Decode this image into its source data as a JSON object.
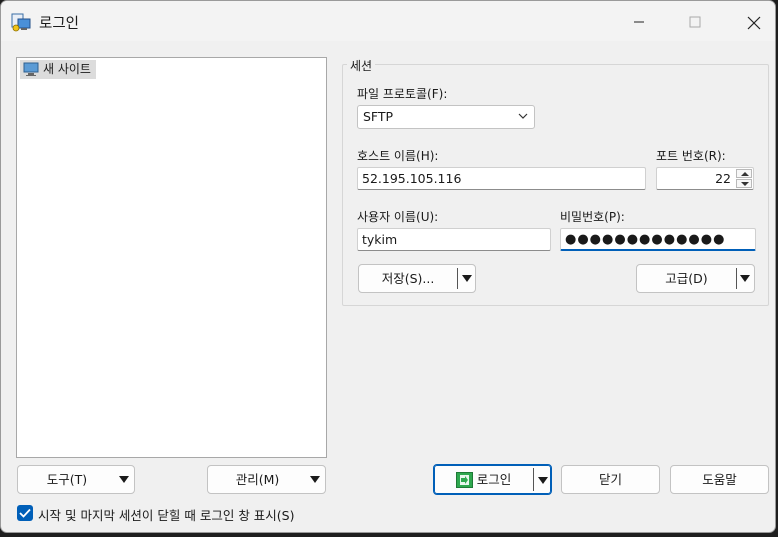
{
  "window": {
    "title": "로그인"
  },
  "site_tree": {
    "items": [
      {
        "label": "새 사이트",
        "icon": "new-site-icon"
      }
    ]
  },
  "session": {
    "group_label": "세션",
    "protocol_label": "파일 프로토콜(F):",
    "protocol_value": "SFTP",
    "host_label": "호스트 이름(H):",
    "host_value": "52.195.105.116",
    "port_label": "포트 번호(R):",
    "port_value": "22",
    "user_label": "사용자 이름(U):",
    "user_value": "tykim",
    "password_label": "비밀번호(P):",
    "password_masked": "●●●●●●●●●●●●●",
    "save_label": "저장(S)...",
    "advanced_label": "고급(D)"
  },
  "bottom": {
    "tools_label": "도구(T)",
    "manage_label": "관리(M)",
    "login_label": "로그인",
    "close_label": "닫기",
    "help_label": "도움말",
    "show_on_start_label": "시작 및 마지막 세션이 닫힐 때 로그인 창 표시(S)",
    "show_on_start_checked": true
  },
  "colors": {
    "accent": "#005fb8",
    "window_bg": "#f0f0f0",
    "login_icon_green": "#2fa84f"
  }
}
